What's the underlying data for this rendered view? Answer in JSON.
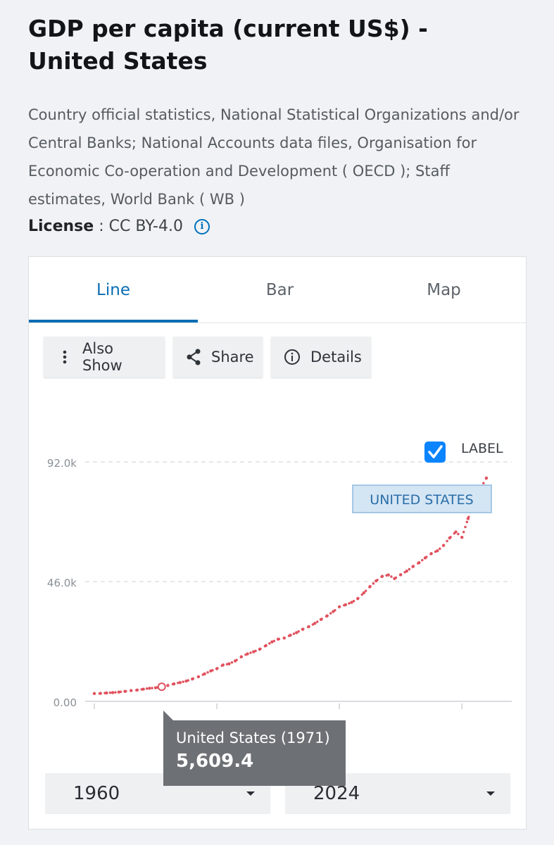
{
  "header": {
    "title": "GDP per capita (current US$) - United States",
    "source": "Country official statistics, National Statistical Organizations and/or Central Banks; National Accounts data files, Organisation for Economic Co-operation and Development ( OECD ); Staff estimates, World Bank ( WB )",
    "license_label": "License",
    "license_sep": " : ",
    "license_value": "CC BY-4.0"
  },
  "tabs": [
    {
      "label": "Line",
      "active": true
    },
    {
      "label": "Bar",
      "active": false
    },
    {
      "label": "Map",
      "active": false
    }
  ],
  "toolbar": {
    "also_show": "Also Show",
    "share": "Share",
    "details": "Details"
  },
  "label_toggle": {
    "label": "LABEL",
    "checked": true
  },
  "series_label": "UNITED STATES",
  "tooltip": {
    "name": "United States (1971)",
    "value": "5,609.4"
  },
  "range": {
    "start": "1960",
    "end": "2024"
  },
  "colors": {
    "accent": "#0a6db3",
    "series": "#e0525e"
  },
  "chart_data": {
    "type": "line",
    "series": [
      {
        "name": "UNITED STATES",
        "x": [
          1960,
          1961,
          1962,
          1963,
          1964,
          1965,
          1966,
          1967,
          1968,
          1969,
          1970,
          1971,
          1972,
          1973,
          1974,
          1975,
          1976,
          1977,
          1978,
          1979,
          1980,
          1981,
          1982,
          1983,
          1984,
          1985,
          1986,
          1987,
          1988,
          1989,
          1990,
          1991,
          1992,
          1993,
          1994,
          1995,
          1996,
          1997,
          1998,
          1999,
          2000,
          2001,
          2002,
          2003,
          2004,
          2005,
          2006,
          2007,
          2008,
          2009,
          2010,
          2011,
          2012,
          2013,
          2014,
          2015,
          2016,
          2017,
          2018,
          2019,
          2020,
          2021,
          2022,
          2023,
          2024
        ],
        "values": [
          3007,
          3067,
          3244,
          3375,
          3574,
          3828,
          4146,
          4336,
          4696,
          5032,
          5234,
          5609,
          6094,
          6726,
          7226,
          7801,
          8592,
          9453,
          10565,
          11674,
          12575,
          13976,
          14434,
          15544,
          17121,
          18237,
          19071,
          20039,
          21417,
          22857,
          23889,
          24342,
          25419,
          26387,
          27695,
          28691,
          29968,
          31459,
          32854,
          34516,
          36330,
          37134,
          38023,
          39496,
          41713,
          44115,
          46300,
          48050,
          48570,
          47195,
          48651,
          50066,
          51784,
          53291,
          55124,
          56763,
          57867,
          59915,
          62805,
          65095,
          63028,
          70219,
          76399,
          81695,
          85810
        ]
      }
    ],
    "yticks": [
      "0.00",
      "46.0k",
      "92.0k"
    ],
    "ylim": [
      0,
      92000
    ],
    "xlim": [
      1960,
      2024
    ],
    "grid": true
  }
}
